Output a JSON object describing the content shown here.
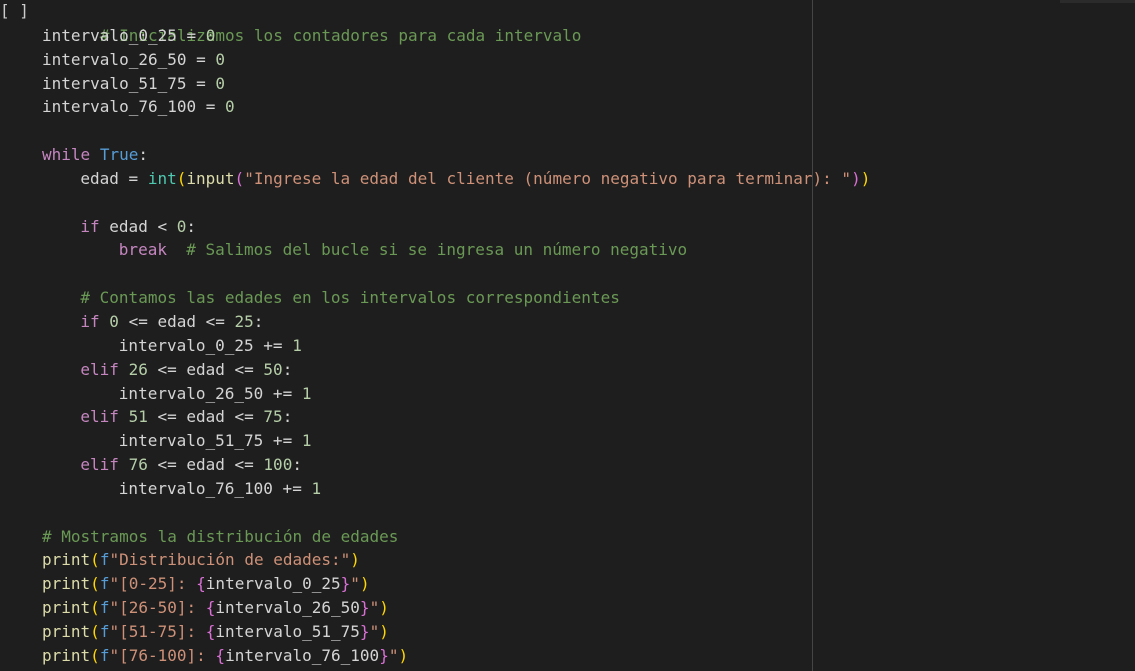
{
  "cell": {
    "run_indicator": "[ ]"
  },
  "code": {
    "l1": {
      "comment": "# Inicializamos los contadores para cada intervalo"
    },
    "l2": {
      "var": "intervalo_0_25",
      "op": " = ",
      "num": "0"
    },
    "l3": {
      "var": "intervalo_26_50",
      "op": " = ",
      "num": "0"
    },
    "l4": {
      "var": "intervalo_51_75",
      "op": " = ",
      "num": "0"
    },
    "l5": {
      "var": "intervalo_76_100",
      "op": " = ",
      "num": "0"
    },
    "l7": {
      "kw": "while",
      "sp": " ",
      "true": "True",
      "colon": ":"
    },
    "l8": {
      "var": "edad",
      "op": " = ",
      "int": "int",
      "p1": "(",
      "input": "input",
      "p2": "(",
      "str": "\"Ingrese la edad del cliente (número negativo para terminar): \"",
      "p3": ")",
      "p4": ")"
    },
    "l10": {
      "kw": "if",
      "rest": " edad < ",
      "num": "0",
      "colon": ":"
    },
    "l11": {
      "kw": "break",
      "sp": "  ",
      "comment": "# Salimos del bucle si se ingresa un número negativo"
    },
    "l13": {
      "comment": "# Contamos las edades en los intervalos correspondientes"
    },
    "l14": {
      "kw": "if",
      "sp": " ",
      "n1": "0",
      "mid": " <= edad <= ",
      "n2": "25",
      "colon": ":"
    },
    "l15": {
      "var": "intervalo_0_25",
      "op": " += ",
      "num": "1"
    },
    "l16": {
      "kw": "elif",
      "sp": " ",
      "n1": "26",
      "mid": " <= edad <= ",
      "n2": "50",
      "colon": ":"
    },
    "l17": {
      "var": "intervalo_26_50",
      "op": " += ",
      "num": "1"
    },
    "l18": {
      "kw": "elif",
      "sp": " ",
      "n1": "51",
      "mid": " <= edad <= ",
      "n2": "75",
      "colon": ":"
    },
    "l19": {
      "var": "intervalo_51_75",
      "op": " += ",
      "num": "1"
    },
    "l20": {
      "kw": "elif",
      "sp": " ",
      "n1": "76",
      "mid": " <= edad <= ",
      "n2": "100",
      "colon": ":"
    },
    "l21": {
      "var": "intervalo_76_100",
      "op": " += ",
      "num": "1"
    },
    "l23": {
      "comment": "# Mostramos la distribución de edades"
    },
    "l24": {
      "fn": "print",
      "p1": "(",
      "f": "f",
      "str": "\"Distribución de edades:\"",
      "p2": ")"
    },
    "l25": {
      "fn": "print",
      "p1": "(",
      "f": "f",
      "s1": "\"[0-25]: ",
      "b1": "{",
      "v": "intervalo_0_25",
      "b2": "}",
      "s2": "\"",
      "p2": ")"
    },
    "l26": {
      "fn": "print",
      "p1": "(",
      "f": "f",
      "s1": "\"[26-50]: ",
      "b1": "{",
      "v": "intervalo_26_50",
      "b2": "}",
      "s2": "\"",
      "p2": ")"
    },
    "l27": {
      "fn": "print",
      "p1": "(",
      "f": "f",
      "s1": "\"[51-75]: ",
      "b1": "{",
      "v": "intervalo_51_75",
      "b2": "}",
      "s2": "\"",
      "p2": ")"
    },
    "l28": {
      "fn": "print",
      "p1": "(",
      "f": "f",
      "s1": "\"[76-100]: ",
      "b1": "{",
      "v": "intervalo_76_100",
      "b2": "}",
      "s2": "\"",
      "p2": ")"
    }
  },
  "colors": {
    "background": "#1e1e1e",
    "comment": "#6a9955",
    "keyword": "#c586c0",
    "keyword_blue": "#569cd6",
    "number": "#b5cea8",
    "function": "#dcdcaa",
    "builtin": "#4ec9b0",
    "string": "#ce9178",
    "paren_level1": "#ffd700",
    "paren_level2": "#da70d6"
  }
}
